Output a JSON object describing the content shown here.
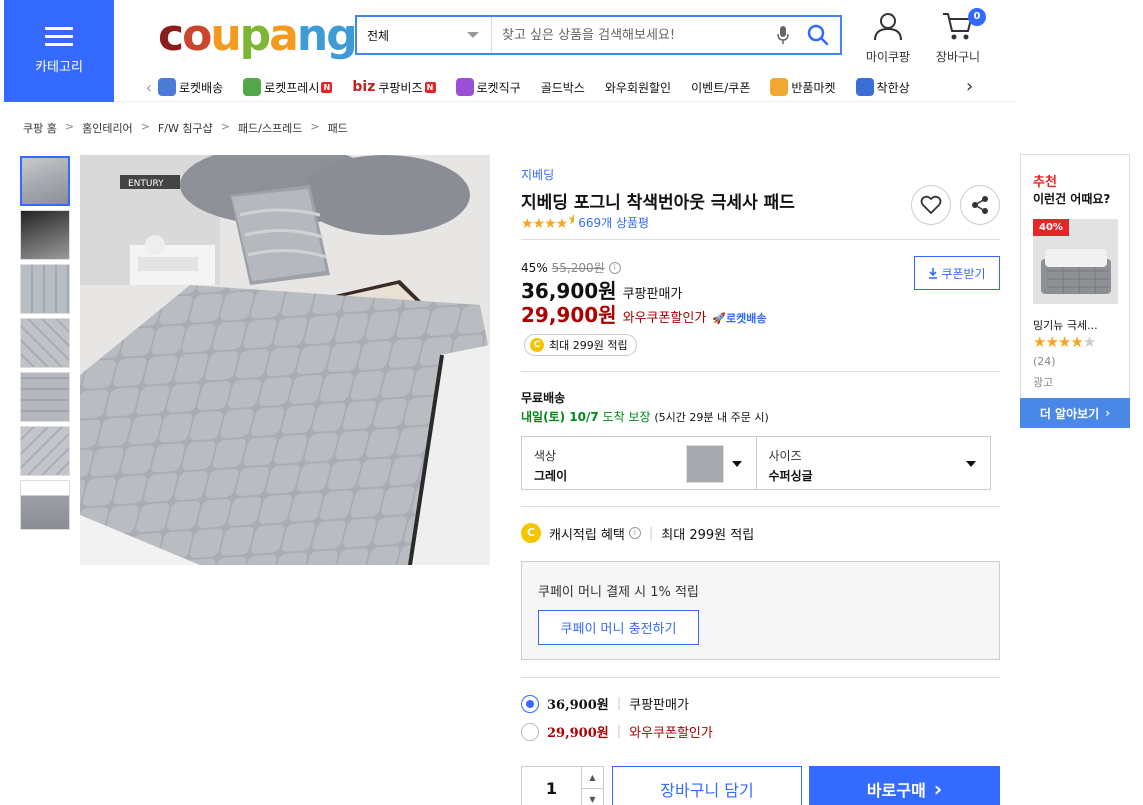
{
  "header": {
    "category_label": "카테고리",
    "logo": [
      "c",
      "o",
      "u",
      "p",
      "a",
      "n",
      "g"
    ],
    "logo_colors": [
      "#8b1d1d",
      "#c9452c",
      "#f39b1f",
      "#7db535",
      "#f39b1f",
      "#3f9bd6",
      "#3f9bd6"
    ],
    "search": {
      "scope": "전체",
      "placeholder": "찾고 싶은 상품을 검색해보세요!"
    },
    "my_coupang": "마이쿠팡",
    "cart": "장바구니",
    "cart_count": "0"
  },
  "nav": {
    "items": [
      {
        "label": "로켓배송",
        "icon": "rocket-icon",
        "color": "#4a7bd8"
      },
      {
        "label": "로켓프레시",
        "icon": "rocket-fresh-icon",
        "color": "#52a84a",
        "badge": "N"
      },
      {
        "label": "쿠팡비즈",
        "prefix": "biz",
        "badge": "N"
      },
      {
        "label": "로켓직구",
        "icon": "rocket-global-icon",
        "color": "#9b4fd6"
      },
      {
        "label": "골드박스"
      },
      {
        "label": "와우회원할인"
      },
      {
        "label": "이벤트/쿠폰"
      },
      {
        "label": "반품마켓",
        "icon": "return-market-icon",
        "color": "#f0a830"
      },
      {
        "label": "착한상",
        "icon": "good-shop-icon",
        "color": "#3a6fd8"
      }
    ]
  },
  "breadcrumb": [
    "쿠팡 홈",
    "홈인테리어",
    "F/W 침구샵",
    "패드/스프레드",
    "패드"
  ],
  "product": {
    "brand": "지베딩",
    "title": "지베딩 포그니 착색번아웃 극세사 패드",
    "rating": 4.5,
    "review_count": "669개 상품평",
    "discount_rate": "45%",
    "original_price": "55,200원",
    "coupang_price": "36,900원",
    "coupang_price_label": "쿠팡판매가",
    "wow_price": "29,900원",
    "wow_price_label": "와우쿠폰할인가",
    "rocket_label": "로켓배송",
    "coupon_button": "쿠폰받기",
    "reward": "최대 299원 적립",
    "shipping_title": "무료배송",
    "shipping_date": "내일(토) 10/7",
    "shipping_arrive": "도착 보장",
    "shipping_note": "(5시간 29분 내 주문 시)",
    "option_color_key": "색상",
    "option_color_value": "그레이",
    "option_size_key": "사이즈",
    "option_size_value": "수퍼싱글",
    "cash_label": "캐시적립 혜택",
    "cash_value": "최대 299원 적립",
    "cpay_text": "쿠페이 머니 결제 시 1% 적립",
    "cpay_button": "쿠페이 머니 충전하기",
    "quantity": "1",
    "add_cart": "장바구니 담기",
    "buy_now": "바로구매"
  },
  "recommend": {
    "tag": "추천",
    "title": "이런건 어때요?",
    "discount": "40%",
    "name": "밍기뉴 극세...",
    "rating": 4,
    "count": "(24)",
    "ad": "광고",
    "more": "더 알아보기"
  }
}
